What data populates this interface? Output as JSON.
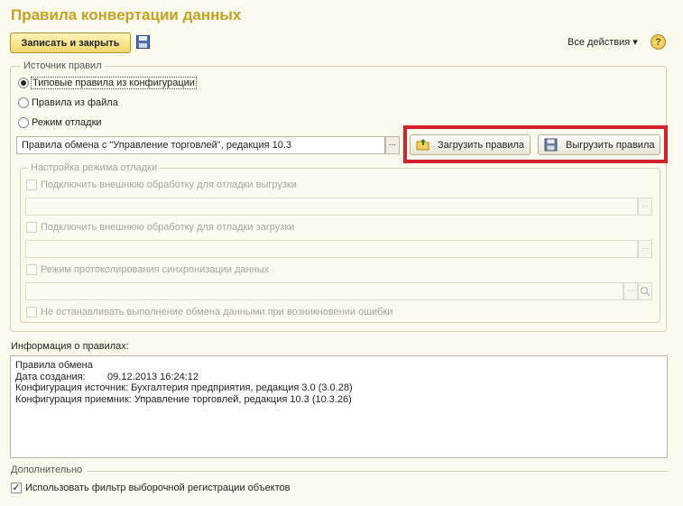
{
  "window": {
    "title": "Правила конвертации данных"
  },
  "toolbar": {
    "save_close_label": "Записать и закрыть",
    "save_icon": "floppy-disk-icon",
    "all_actions_label": "Все действия ▾",
    "help_label": "?"
  },
  "rules_source": {
    "legend": "Источник правил",
    "options": [
      {
        "label": "Типовые правила из конфигурации",
        "selected": true
      },
      {
        "label": "Правила из файла",
        "selected": false
      },
      {
        "label": "Режим отладки",
        "selected": false
      }
    ],
    "rules_field_value": "Правила обмена с \"Управление торговлей\", редакция 10.3",
    "select_button_label": "...",
    "load_button_label": "Загрузить правила",
    "unload_button_label": "Выгрузить правила",
    "highlight_color": "#d9202a"
  },
  "debug": {
    "legend": "Настройка режима отладки",
    "export_checkbox_label": "Подключить внешнюю обработку для отладки выгрузки",
    "import_checkbox_label": "Подключить внешнюю обработку для отладки загрузки",
    "log_checkbox_label": "Режим протоколирования синхронизации данных",
    "continue_checkbox_label": "Не останавливать выполнение обмена данными при возникновении ошибки",
    "export_field_value": "",
    "import_field_value": "",
    "log_field_value": ""
  },
  "info": {
    "label": "Информация о правилах:",
    "lines": [
      "Правила обмена",
      "Дата создания:        09.12.2013 16:24:12",
      "Конфигурация источник: Бухгалтерия предприятия, редакция 3.0 (3.0.28)",
      "Конфигурация приемник: Управление торговлей, редакция 10.3 (10.3.26)"
    ]
  },
  "additional": {
    "legend": "Дополнительно",
    "filter_checkbox_label": "Использовать фильтр выборочной регистрации объектов",
    "filter_checked": true
  },
  "colors": {
    "title": "#c5a11f",
    "background": "#fbfaee",
    "primary_button": "#f3d66b"
  }
}
